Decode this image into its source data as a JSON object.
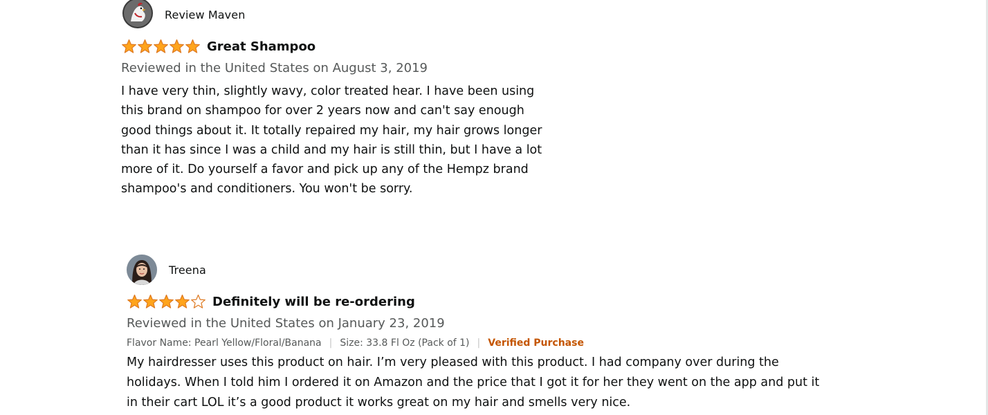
{
  "reviews": [
    {
      "profile_name": "Review Maven",
      "avatar_icon": "user-avatar-rooster",
      "rating": 5,
      "rating_max": 5,
      "title": "Great Shampoo",
      "date_line": "Reviewed in the United States on August 3, 2019",
      "body": "I have very thin, slightly wavy, color treated hear. I have been using\nthis brand on shampoo for over 2 years now and can't say enough\ngood things about it. It totally repaired my hair, my hair grows longer\nthan it has since I was a child and my hair is still thin, but I have a lot\nmore of it. Do yourself a favor and pick up any of the Hempz brand\nshampoo's and conditioners. You won't be sorry."
    },
    {
      "profile_name": "Treena",
      "avatar_icon": "user-avatar-photo",
      "rating": 4,
      "rating_max": 5,
      "title": "Definitely will be re-ordering",
      "date_line": "Reviewed in the United States on January 23, 2019",
      "flavor": "Flavor Name: Pearl Yellow/Floral/Banana",
      "size": "Size: 33.8 Fl Oz (Pack of 1)",
      "verified": "Verified Purchase",
      "body": "My hairdresser uses this product on hair. I’m very pleased with this product. I had company over during the\nholidays. When I told him I ordered it on Amazon and the price that I got it for her they went on the app and put it\nin their cart LOL it’s a good product it works great on my hair and smells very nice."
    }
  ],
  "colors": {
    "star_fill": "#ffa41c",
    "star_stroke": "#de7921",
    "secondary_text": "#565959",
    "verified": "#c45500",
    "divider": "#c6c6c6"
  }
}
